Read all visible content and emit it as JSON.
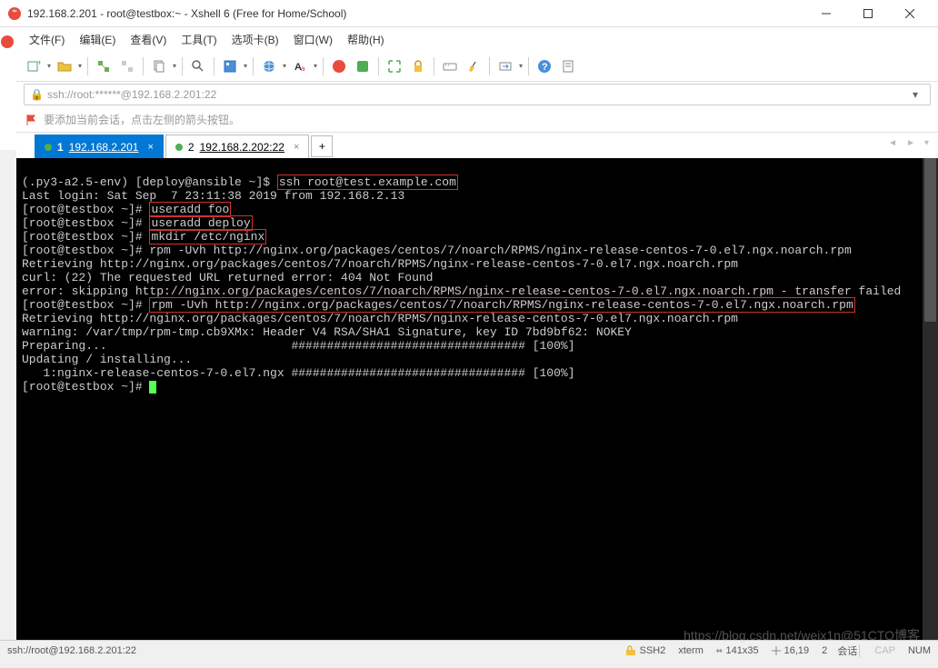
{
  "window": {
    "title": "192.168.2.201 - root@testbox:~ - Xshell 6 (Free for Home/School)"
  },
  "menu": {
    "file": "文件(F)",
    "edit": "编辑(E)",
    "view": "查看(V)",
    "tools": "工具(T)",
    "tabs": "选项卡(B)",
    "window": "窗口(W)",
    "help": "帮助(H)"
  },
  "address": {
    "url": "ssh://root:******@192.168.2.201:22"
  },
  "info": {
    "hint": "要添加当前会话，点击左侧的箭头按钮。"
  },
  "tabs": {
    "items": [
      {
        "num": "1",
        "label": "192.168.2.201",
        "active": true
      },
      {
        "num": "2",
        "label": "192.168.2.202:22",
        "active": false
      }
    ],
    "add": "+"
  },
  "terminal": {
    "line1_pre": "(.py3-a2.5-env) [deploy@ansible ~]$ ",
    "line1_cmd": "ssh root@test.example.com",
    "line2": "Last login: Sat Sep  7 23:11:38 2019 from 192.168.2.13",
    "line3_pre": "[root@testbox ~]# ",
    "line3_cmd": "useradd foo",
    "line4_pre": "[root@testbox ~]# ",
    "line4_cmd": "useradd deploy",
    "line5_pre": "[root@testbox ~]# ",
    "line5_cmd": "mkdir /etc/nginx",
    "line6_pre": "[root@testbox ~]# ",
    "line6_cmd": "rpm -Uvh http://nginx.org/packages/centos/7/noarch/RPMS/nginx-release-centos-7-0.el7.ngx.noarch.rpm",
    "line7": "Retrieving http://nginx.org/packages/centos/7/noarch/RPMS/nginx-release-centos-7-0.el7.ngx.noarch.rpm",
    "line8": "curl: (22) The requested URL returned error: 404 Not Found",
    "line9": "error: skipping http://nginx.org/packages/centos/7/noarch/RPMS/nginx-release-centos-7-0.el7.ngx.noarch.rpm - transfer failed",
    "line10_pre": "[root@testbox ~]# ",
    "line10_cmd": "rpm -Uvh http://nginx.org/packages/centos/7/noarch/RPMS/nginx-release-centos-7-0.el7.ngx.noarch.rpm",
    "line11": "Retrieving http://nginx.org/packages/centos/7/noarch/RPMS/nginx-release-centos-7-0.el7.ngx.noarch.rpm",
    "line12": "warning: /var/tmp/rpm-tmp.cb9XMx: Header V4 RSA/SHA1 Signature, key ID 7bd9bf62: NOKEY",
    "line13": "Preparing...                          ################################# [100%]",
    "line14": "Updating / installing...",
    "line15": "   1:nginx-release-centos-7-0.el7.ngx ################################# [100%]",
    "line16_pre": "[root@testbox ~]# "
  },
  "status": {
    "path": "ssh://root@192.168.2.201:22",
    "proto": "SSH2",
    "term": "xterm",
    "size": "141x35",
    "pos": "16,19",
    "sessions_label": "会话",
    "sessions": "2",
    "cap": "CAP",
    "num": "NUM"
  },
  "watermark": "https://blog.csdn.net/weix1n@51CTO博客"
}
